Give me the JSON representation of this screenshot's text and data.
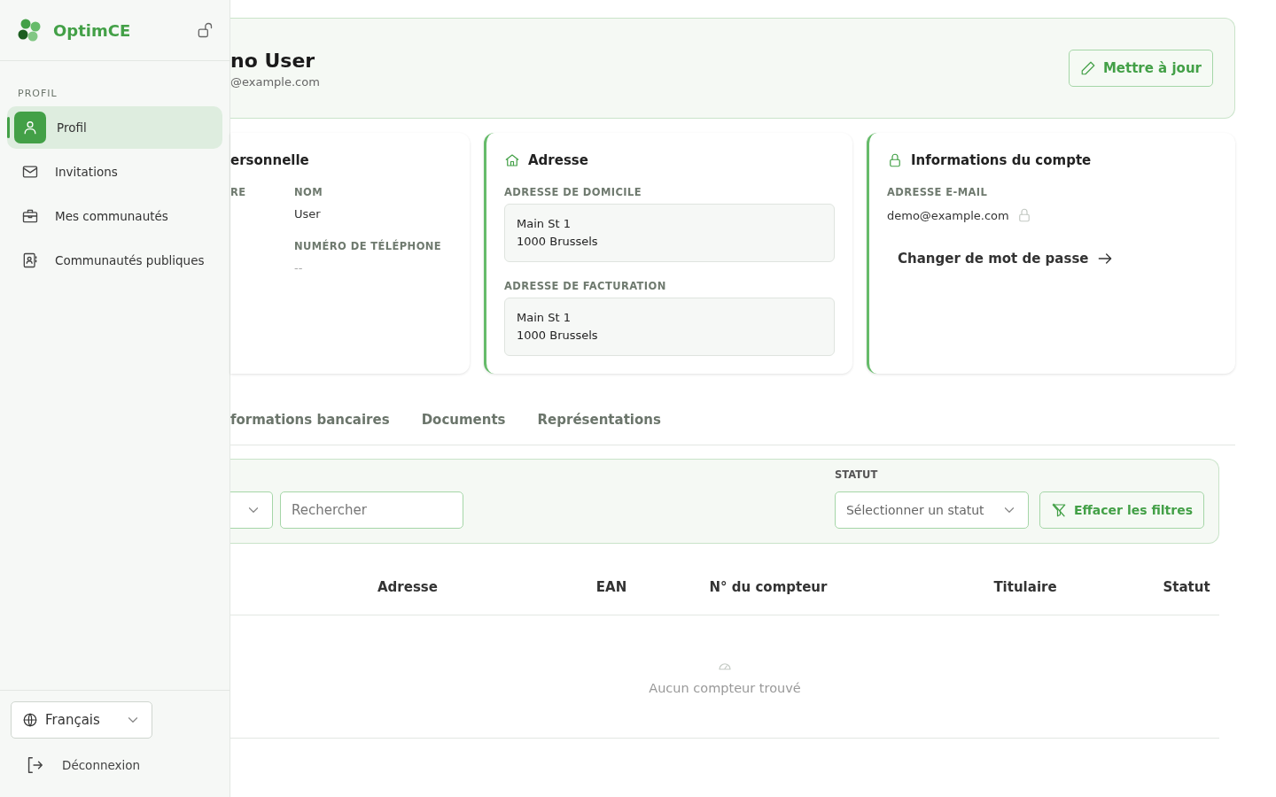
{
  "sidebar": {
    "brand": "OptimCE",
    "section_label": "PROFIL",
    "items": [
      {
        "label": "Profil",
        "selected": true
      },
      {
        "label": "Invitations",
        "selected": false
      },
      {
        "label": "Mes communautés",
        "selected": false
      },
      {
        "label": "Communautés publiques",
        "selected": false
      }
    ],
    "language": "Français",
    "logout": "Déconnexion"
  },
  "header": {
    "name": "no User",
    "email": "@example.com",
    "update_button": "Mettre à jour"
  },
  "personal_card": {
    "title": "ersonnelle",
    "fields": [
      {
        "label": "RE"
      },
      {
        "label": "NOM",
        "value": "User"
      },
      {
        "label": "NUMÉRO DE TÉLÉPHONE",
        "value": "--"
      }
    ]
  },
  "address_card": {
    "title": "Adresse",
    "blocks": [
      {
        "label": "ADRESSE DE DOMICILE",
        "lines": [
          "Main St 1",
          "1000 Brussels"
        ]
      },
      {
        "label": "ADRESSE DE FACTURATION",
        "lines": [
          "Main St 1",
          "1000 Brussels"
        ]
      }
    ]
  },
  "account_card": {
    "title": "Informations du compte",
    "email_label": "ADRESSE E-MAIL",
    "email": "demo@example.com",
    "change_password": "Changer de mot de passe"
  },
  "tabs": [
    {
      "label": "formations bancaires",
      "selected": false
    },
    {
      "label": "Documents",
      "selected": false
    },
    {
      "label": "Représentations",
      "selected": false
    }
  ],
  "filters": {
    "search_placeholder": "Rechercher",
    "status_label": "STATUT",
    "status_placeholder": "Sélectionner un statut",
    "clear_button": "Effacer les filtres"
  },
  "table": {
    "columns": [
      "Adresse",
      "EAN",
      "N° du compteur",
      "Titulaire",
      "Statut"
    ],
    "empty_message": "Aucun compteur trouvé"
  }
}
